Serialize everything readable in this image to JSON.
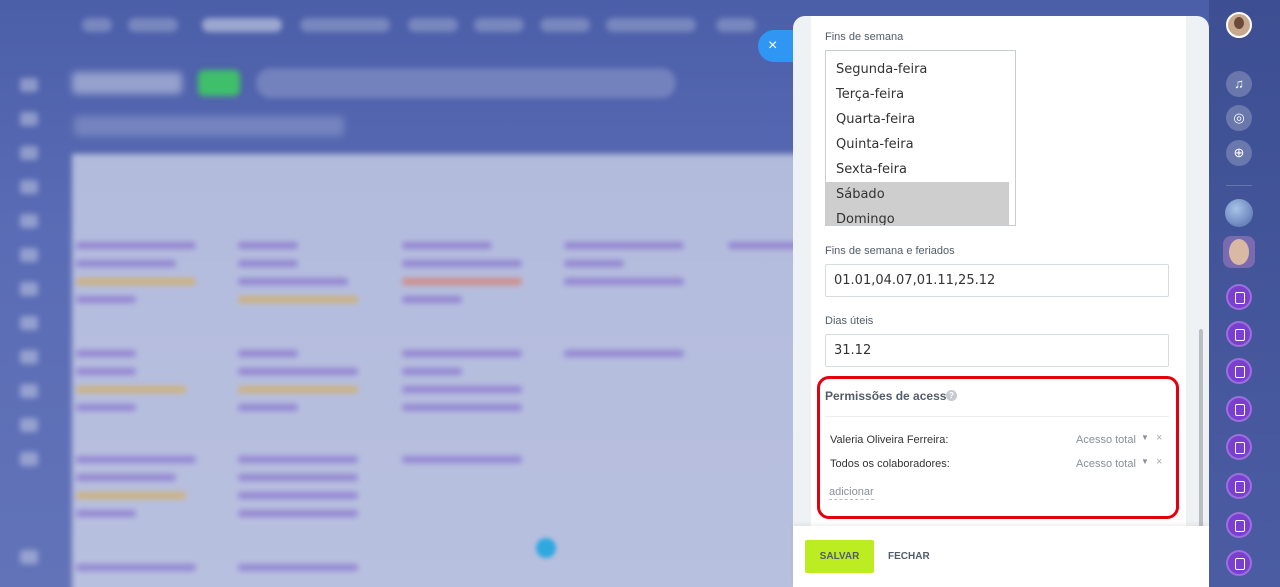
{
  "form": {
    "weekends_label": "Fins de semana",
    "weekdays": [
      {
        "label": "Segunda-feira",
        "selected": false
      },
      {
        "label": "Terça-feira",
        "selected": false
      },
      {
        "label": "Quarta-feira",
        "selected": false
      },
      {
        "label": "Quinta-feira",
        "selected": false
      },
      {
        "label": "Sexta-feira",
        "selected": false
      },
      {
        "label": "Sábado",
        "selected": true
      },
      {
        "label": "Domingo",
        "selected": true
      }
    ],
    "holidays_label": "Fins de semana e feriados",
    "holidays_value": "01.01,04.07,01.11,25.12",
    "workdays_label": "Dias úteis",
    "workdays_value": "31.12"
  },
  "permissions": {
    "title": "Permissões de acesso",
    "help_icon": "?",
    "rows": [
      {
        "name": "Valeria Oliveira Ferreira:",
        "access": "Acesso total",
        "remove": "×"
      },
      {
        "name": "Todos os colaboradores:",
        "access": "Acesso total",
        "remove": "×"
      }
    ],
    "add_label": "adicionar"
  },
  "footer": {
    "save_label": "SALVAR",
    "close_label": "FECHAR"
  },
  "slider_close": "×",
  "colors": {
    "save_button": "#bbed21",
    "highlight": "#e3000f",
    "close_button": "#2f96f3",
    "selected_option": "#cecece"
  },
  "icons": {
    "close": "close-icon",
    "help": "question-circle-icon",
    "dropdown": "caret-down-icon",
    "remove": "remove-icon",
    "bell": "bell-icon",
    "spiral": "copilot-icon",
    "search": "search-chat-icon"
  }
}
